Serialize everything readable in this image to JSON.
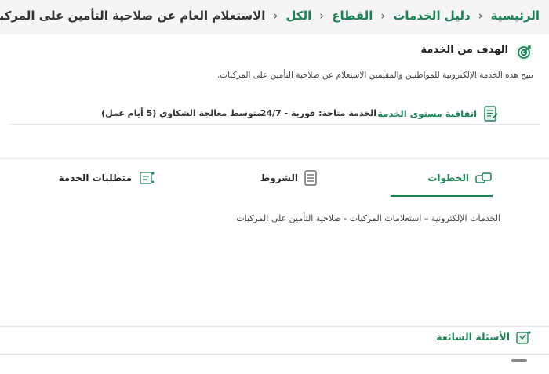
{
  "breadcrumb": {
    "items": [
      "الرئيسية",
      "دليل الخدمات",
      "القطاع",
      "الكل"
    ],
    "current": "الاستعلام العام عن صلاحية التأمين على المركبات",
    "separator": "›"
  },
  "goal": {
    "title": "الهدف من الخدمة",
    "description": "تتيح هذه الخدمة الإلكترونية للمواطنين والمقيمين الاستعلام عن صلاحية التأمين على المركبات."
  },
  "sla": {
    "title": "اتفاقية مستوى الخدمة",
    "availability": "الخدمة متاحة: فورية - 24/7",
    "complaints": "متوسط معالجة الشكاوى (5 أيام عمل)"
  },
  "tabs": [
    {
      "label": "الخطوات",
      "icon": "steps-icon",
      "active": true
    },
    {
      "label": "الشروط",
      "icon": "conditions-icon",
      "active": false
    },
    {
      "label": "متطلبات الخدمة",
      "icon": "requirements-icon",
      "active": false
    }
  ],
  "steps_content": "الخدمات الإلكترونية – استعلامات المركبات - صلاحية التأمين على المركبات",
  "faq": {
    "title": "الأسئلة الشائعة"
  },
  "colors": {
    "accent": "#1b8354",
    "background": "#f5f5f5"
  }
}
